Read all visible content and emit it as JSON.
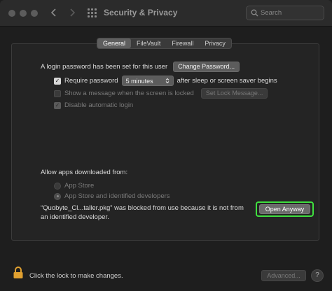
{
  "window": {
    "title": "Security & Privacy",
    "back_icon": "chevron-left-icon",
    "forward_icon": "chevron-right-icon",
    "grid_icon": "show-all-grid-icon"
  },
  "search": {
    "placeholder": "Search"
  },
  "tabs": [
    {
      "label": "General",
      "active": true
    },
    {
      "label": "FileVault",
      "active": false
    },
    {
      "label": "Firewall",
      "active": false
    },
    {
      "label": "Privacy",
      "active": false
    }
  ],
  "general": {
    "login_text": "A login password has been set for this user",
    "change_password_label": "Change Password...",
    "require_password_label": "Require password",
    "require_password_checked": true,
    "require_password_delay": "5 minutes",
    "after_sleep_text": "after sleep or screen saver begins",
    "show_message_label": "Show a message when the screen is locked",
    "show_message_checked": false,
    "set_lock_message_label": "Set Lock Message...",
    "disable_autologin_label": "Disable automatic login",
    "disable_autologin_checked": true
  },
  "apps": {
    "heading": "Allow apps downloaded from:",
    "option_app_store": "App Store",
    "option_identified": "App Store and identified developers",
    "selected": "App Store and identified developers",
    "blocked_line1": "“Quobyte_Cl...taller.pkg” was blocked from use because it is not from",
    "blocked_line2": "an identified developer.",
    "open_anyway_label": "Open Anyway",
    "highlight_color": "#3fe03f"
  },
  "footer": {
    "lock_text": "Click the lock to make changes.",
    "advanced_label": "Advanced...",
    "help_label": "?"
  },
  "colors": {
    "background": "#1e1e1e",
    "titlebar": "#2b2b2b",
    "lock_gold": "#e0a030"
  }
}
